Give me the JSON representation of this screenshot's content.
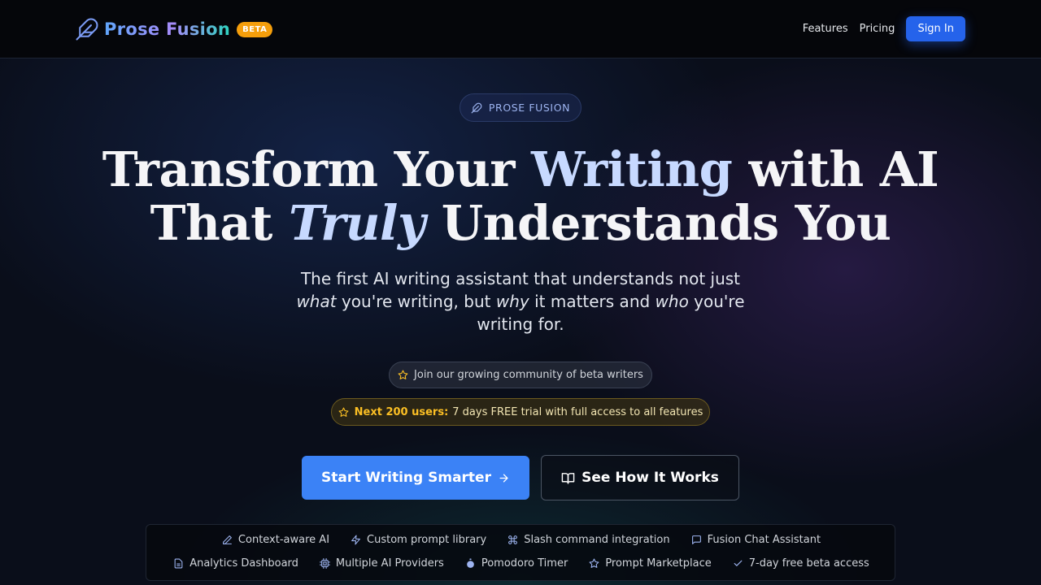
{
  "nav": {
    "brand": "Prose Fusion",
    "badge": "BETA",
    "links": [
      "Features",
      "Pricing"
    ],
    "signin": "Sign In"
  },
  "hero": {
    "pill": "PROSE FUSION",
    "headline": {
      "l1a": "Transform Your ",
      "l1b": "Writing",
      "l1c": " with AI",
      "l2a": "That ",
      "l2b": "Truly",
      "l2c": " Understands You"
    },
    "sub": {
      "s1": "The first AI writing assistant that understands not just",
      "s2": "what",
      "s3": " you're writing, but ",
      "s4": "why",
      "s5": " it matters and ",
      "s6": "who",
      "s7": " you're writing for."
    },
    "community": "Join our growing community of beta writers",
    "promo_bold": "Next 200 users:",
    "promo_text": "7 days FREE trial with full access to all features",
    "cta_primary": "Start Writing Smarter",
    "cta_secondary": "See How It Works"
  },
  "features": {
    "row1": [
      {
        "icon": "pencil-icon",
        "label": "Context-aware AI"
      },
      {
        "icon": "lightning-icon",
        "label": "Custom prompt library"
      },
      {
        "icon": "command-icon",
        "label": "Slash command integration"
      },
      {
        "icon": "chat-icon",
        "label": "Fusion Chat Assistant"
      }
    ],
    "row2": [
      {
        "icon": "document-icon",
        "label": "Analytics Dashboard"
      },
      {
        "icon": "chip-icon",
        "label": "Multiple AI Providers"
      },
      {
        "icon": "timer-icon",
        "label": "Pomodoro Timer"
      },
      {
        "icon": "star-icon",
        "label": "Prompt Marketplace"
      },
      {
        "icon": "check-icon",
        "label": "7-day free beta access"
      }
    ]
  },
  "colors": {
    "accent": "#2563eb",
    "primary_button": "#3b82f6",
    "badge": "#f59e0b",
    "promo": "#fbbf24"
  }
}
